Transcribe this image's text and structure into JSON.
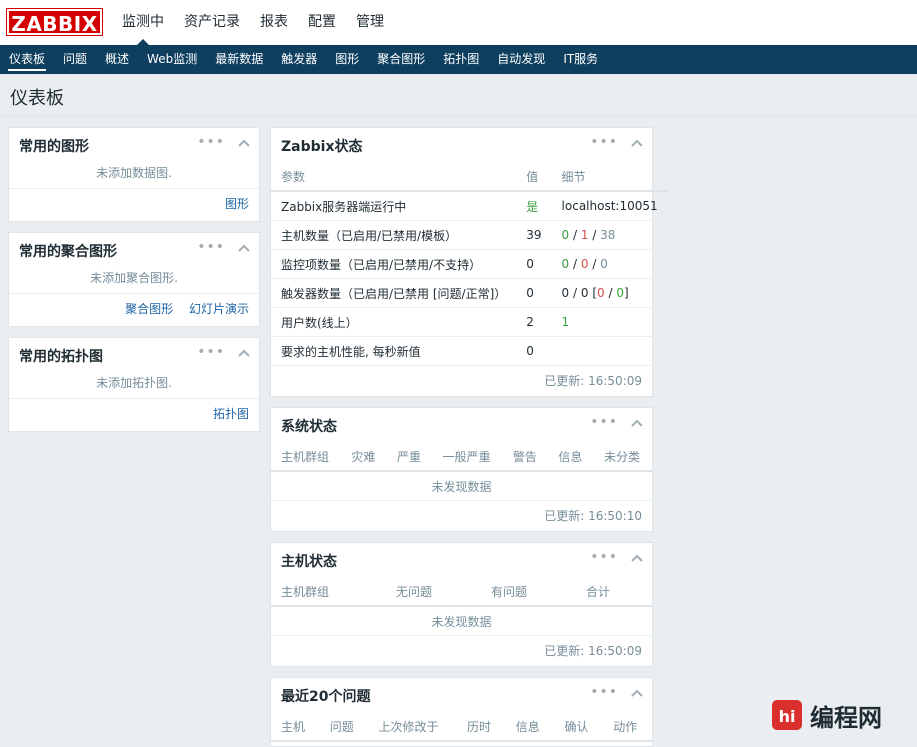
{
  "logo": "ZABBIX",
  "topnav": [
    "监测中",
    "资产记录",
    "报表",
    "配置",
    "管理"
  ],
  "subnav": [
    "仪表板",
    "问题",
    "概述",
    "Web监测",
    "最新数据",
    "触发器",
    "图形",
    "聚合图形",
    "拓扑图",
    "自动发现",
    "IT服务"
  ],
  "page_title": "仪表板",
  "fav_graphs": {
    "title": "常用的图形",
    "empty": "未添加数据图.",
    "links": [
      "图形"
    ]
  },
  "fav_screens": {
    "title": "常用的聚合图形",
    "empty": "未添加聚合图形.",
    "links": [
      "聚合图形",
      "幻灯片演示"
    ]
  },
  "fav_maps": {
    "title": "常用的拓扑图",
    "empty": "未添加拓扑图.",
    "links": [
      "拓扑图"
    ]
  },
  "zabbix_status": {
    "title": "Zabbix状态",
    "headers": [
      "参数",
      "值",
      "细节"
    ],
    "rows": [
      {
        "param": "Zabbix服务器端运行中",
        "value": "是",
        "detail": "localhost:10051"
      },
      {
        "param": "主机数量（已启用/已禁用/模板）",
        "value": "39",
        "d1": "0",
        "d2": "1",
        "d3": "38"
      },
      {
        "param": "监控项数量（已启用/已禁用/不支持）",
        "value": "0",
        "d1": "0",
        "d2": "0",
        "d3": "0"
      },
      {
        "param": "触发器数量（已启用/已禁用 [问题/正常]）",
        "value": "0",
        "d1": "0",
        "d2": "0",
        "d3": "0",
        "d4": "0"
      },
      {
        "param": "用户数(线上）",
        "value": "2",
        "detail": "1"
      },
      {
        "param": "要求的主机性能, 每秒新值",
        "value": "0",
        "detail": ""
      }
    ],
    "updated": "已更新: 16:50:09"
  },
  "system_status": {
    "title": "系统状态",
    "headers": [
      "主机群组",
      "灾难",
      "严重",
      "一般严重",
      "警告",
      "信息",
      "未分类"
    ],
    "empty": "未发现数据",
    "updated": "已更新: 16:50:10"
  },
  "host_status": {
    "title": "主机状态",
    "headers": [
      "主机群组",
      "无问题",
      "有问题",
      "合计"
    ],
    "empty": "未发现数据",
    "updated": "已更新: 16:50:09"
  },
  "last_issues": {
    "title": "最近20个问题",
    "headers": [
      "主机",
      "问题",
      "上次修改于",
      "历时",
      "信息",
      "确认",
      "动作"
    ]
  },
  "watermark": "编程网",
  "colors": {
    "navy": "#0e3f5f",
    "logo_red": "#d40000",
    "ok_green": "#3b9f3f",
    "problem_red": "#d64e4e"
  }
}
